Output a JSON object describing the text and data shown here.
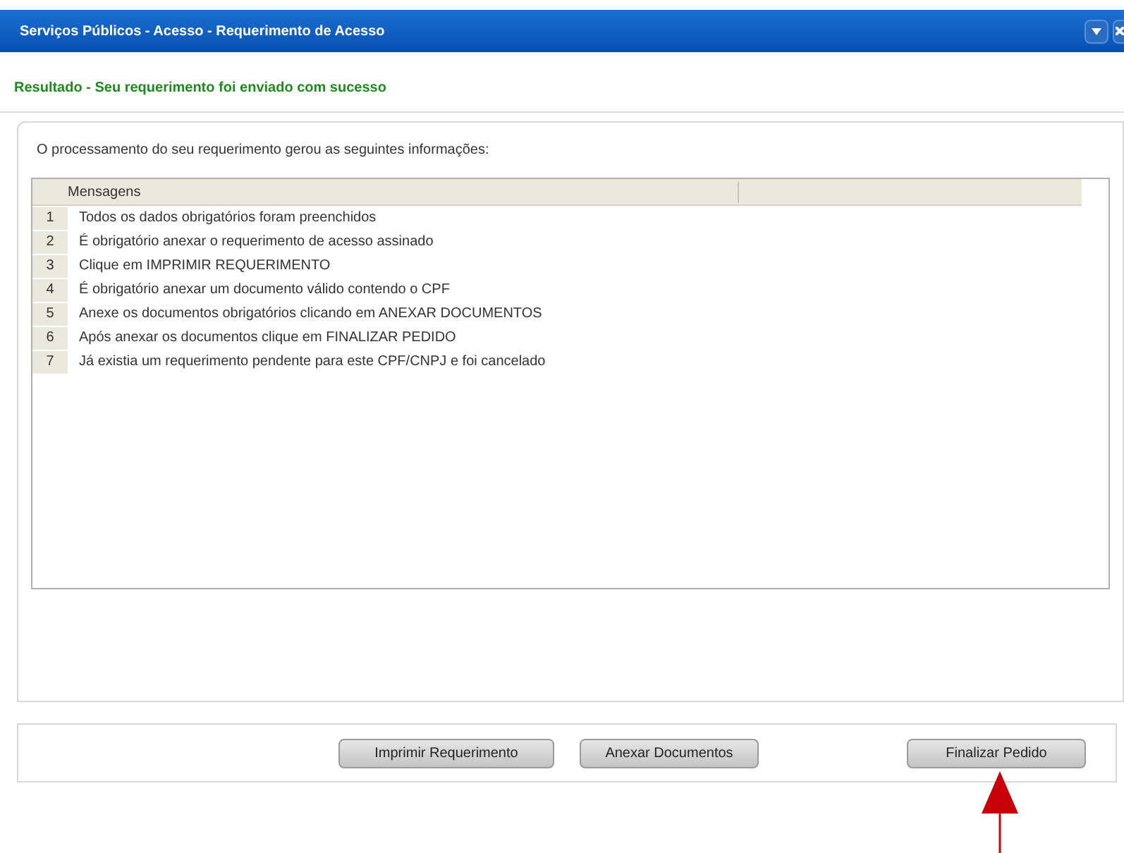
{
  "window": {
    "title": "Serviços Públicos - Acesso - Requerimento de Acesso"
  },
  "result_heading": "Resultado - Seu requerimento foi enviado com sucesso",
  "intro": "O processamento do seu requerimento gerou as seguintes informações:",
  "table": {
    "columns": [
      "Mensagens"
    ],
    "rows": [
      {
        "number": "1",
        "message": "Todos os dados obrigatórios foram preenchidos"
      },
      {
        "number": "2",
        "message": "É obrigatório anexar o requerimento de acesso assinado"
      },
      {
        "number": "3",
        "message": "Clique em IMPRIMIR REQUERIMENTO"
      },
      {
        "number": "4",
        "message": "É obrigatório anexar um documento válido contendo o CPF"
      },
      {
        "number": "5",
        "message": "Anexe os documentos obrigatórios clicando em ANEXAR DOCUMENTOS"
      },
      {
        "number": "6",
        "message": "Após anexar os documentos clique em FINALIZAR PEDIDO"
      },
      {
        "number": "7",
        "message": "Já existia um requerimento pendente para este CPF/CNPJ e foi cancelado"
      }
    ]
  },
  "buttons": [
    "Imprimir Requerimento",
    "Anexar Documentos",
    "Finalizar Pedido"
  ]
}
